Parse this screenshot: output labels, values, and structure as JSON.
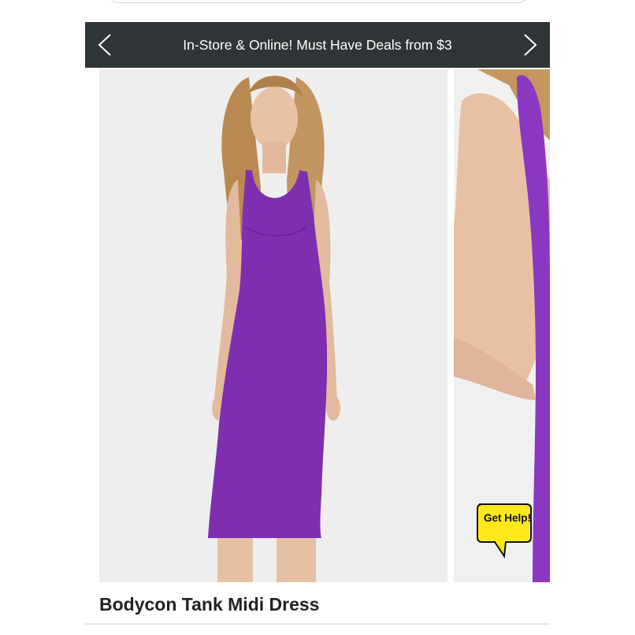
{
  "promo_banner": {
    "text": "In-Store & Online! Must Have Deals from $3",
    "prev_icon": "chevron-left-icon",
    "next_icon": "chevron-right-icon"
  },
  "gallery": {
    "main_image_alt": "model wearing purple bodycon tank midi dress",
    "next_image_alt": "close-up of purple dress side",
    "dress_color": "#7d2fb0"
  },
  "help_button": {
    "label": "Get Help!",
    "icon": "speech-bubble-icon",
    "color": "#ffe81a"
  },
  "product": {
    "title": "Bodycon Tank Midi Dress"
  }
}
